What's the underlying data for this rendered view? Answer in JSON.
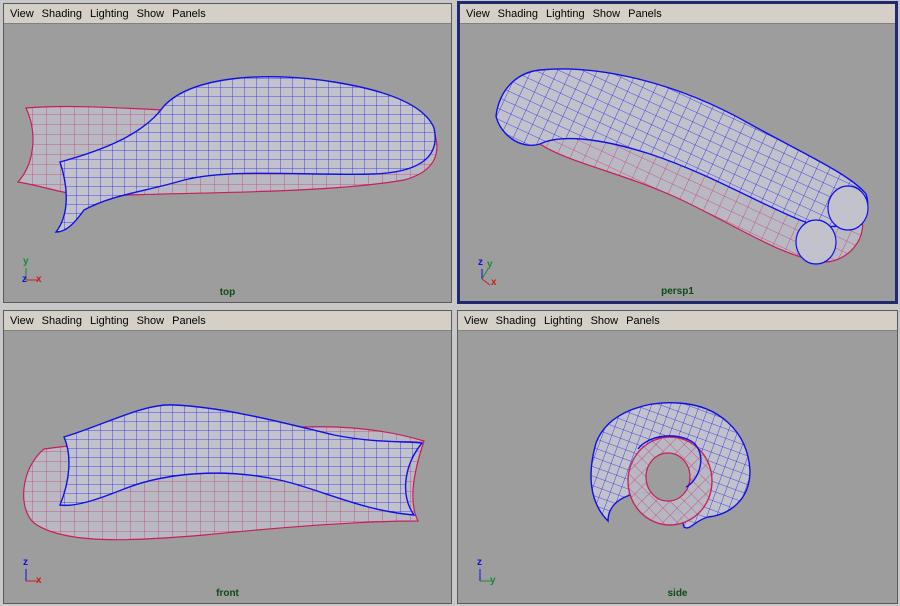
{
  "menu": [
    "View",
    "Shading",
    "Lighting",
    "Show",
    "Panels"
  ],
  "panels": {
    "top": {
      "label": "top",
      "axes": [
        "y",
        "z",
        "x"
      ]
    },
    "persp": {
      "label": "persp1",
      "axes": [
        "z",
        "y",
        "x"
      ]
    },
    "front": {
      "label": "front",
      "axes": [
        "z",
        "x"
      ]
    },
    "side": {
      "label": "side",
      "axes": [
        "z",
        "y"
      ]
    }
  },
  "colors": {
    "viewport_bg": "#9d9d9d",
    "wire_blue": "#1010e6",
    "wire_red": "#c81e5a",
    "surface": "#b9b9c4"
  }
}
